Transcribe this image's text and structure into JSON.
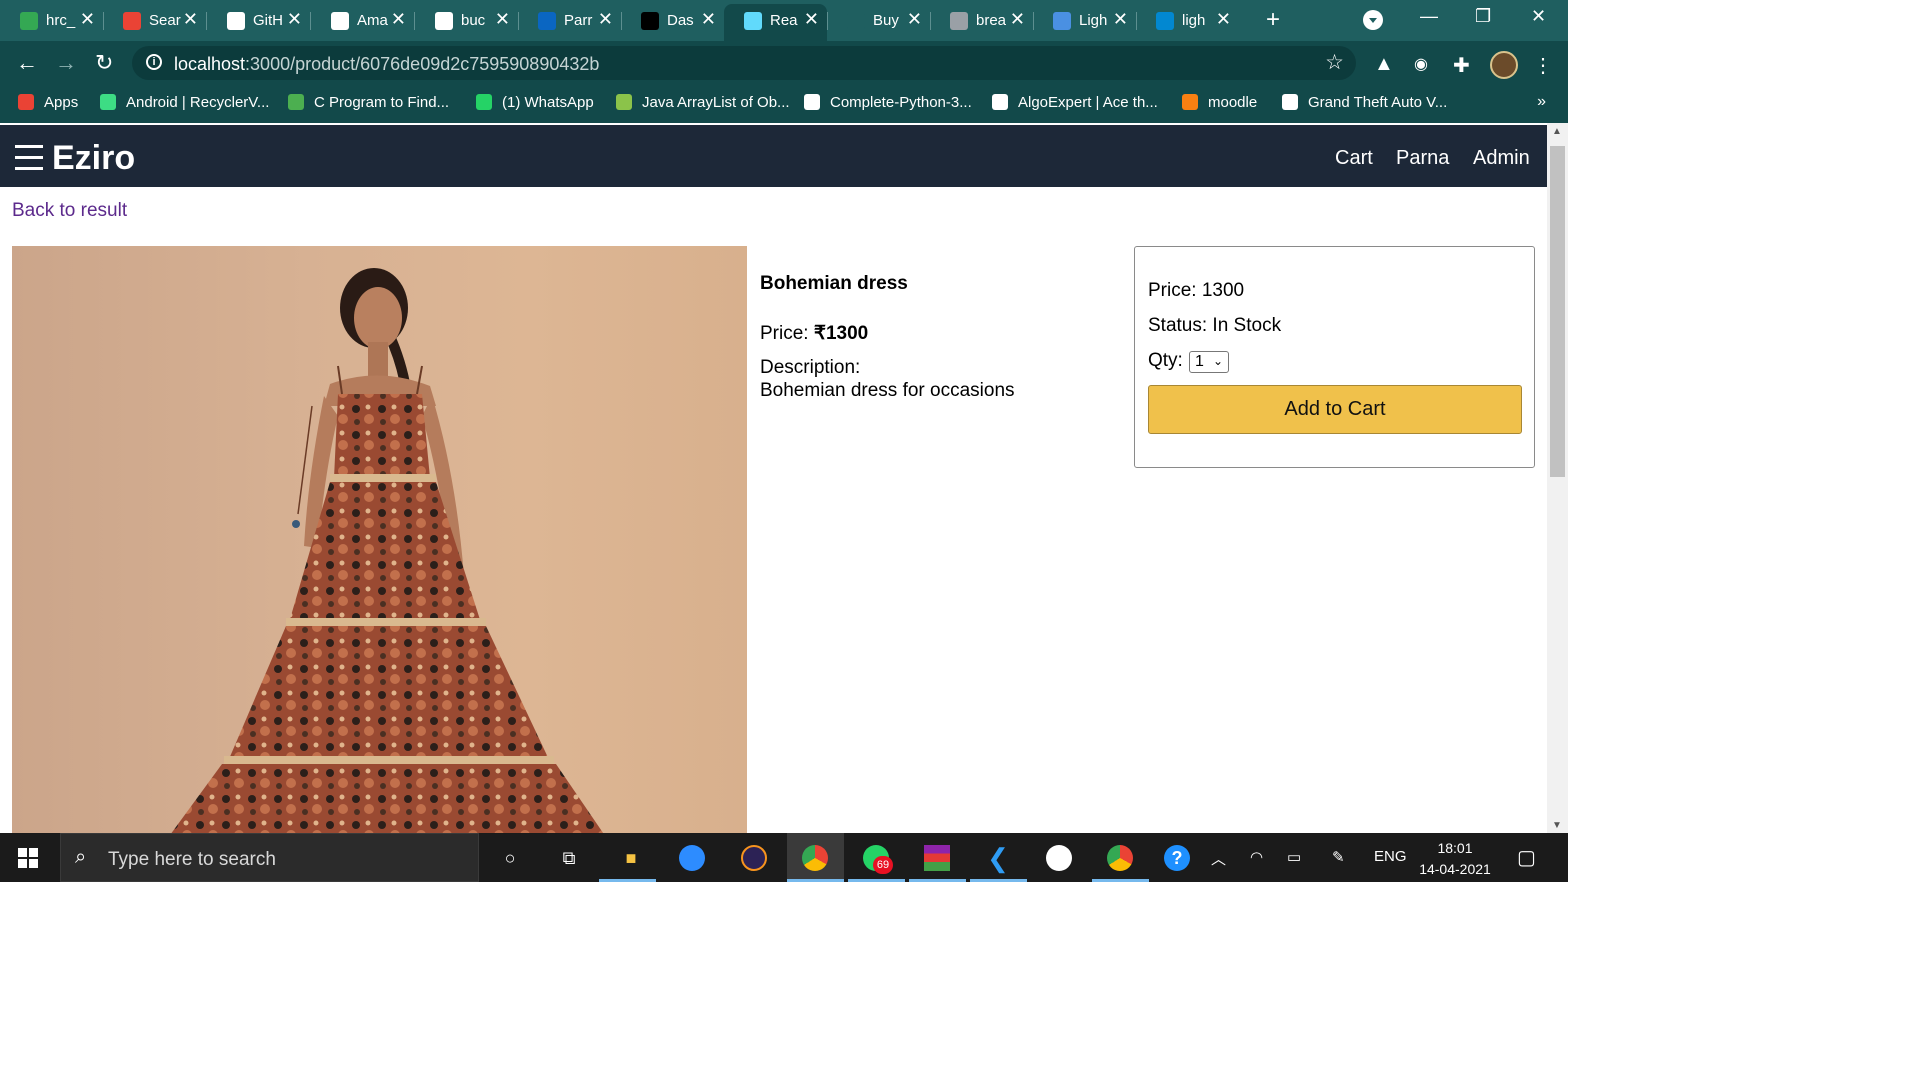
{
  "browser": {
    "tabs": [
      {
        "label": "hrc_",
        "icon": "google-drive-icon",
        "color": "#34a853"
      },
      {
        "label": "Sear",
        "icon": "gmail-icon",
        "color": "#ea4335"
      },
      {
        "label": "GitH",
        "icon": "github-icon",
        "color": "#ffffff"
      },
      {
        "label": "Ama",
        "icon": "amazon-icon",
        "color": "#ffffff"
      },
      {
        "label": "buc",
        "icon": "google-icon",
        "color": "#ffffff"
      },
      {
        "label": "Parr",
        "icon": "linkedin-icon",
        "color": "#0a66c2"
      },
      {
        "label": "Das",
        "icon": "dashboard-icon",
        "color": "#000000"
      },
      {
        "label": "Rea",
        "icon": "react-icon",
        "color": "#61dafb"
      },
      {
        "label": "Buy",
        "icon": "shop-icon",
        "color": "#1f5f60"
      },
      {
        "label": "brea",
        "icon": "globe-icon",
        "color": "#9aa0a6"
      },
      {
        "label": "Ligh",
        "icon": "colorzilla-icon",
        "color": "#4a90e2"
      },
      {
        "label": "ligh",
        "icon": "c-icon",
        "color": "#0288d1"
      }
    ],
    "active_tab_index": 7,
    "url_host": "localhost",
    "url_path": ":3000/product/6076de09d2c759590890432b",
    "bookmarks": [
      {
        "label": "Apps",
        "icon": "apps-grid-icon",
        "color": "#ea4335"
      },
      {
        "label": "Android | RecyclerV...",
        "icon": "android-icon",
        "color": "#3ddc84"
      },
      {
        "label": "C Program to Find...",
        "icon": "site-icon",
        "color": "#4caf50"
      },
      {
        "label": "(1) WhatsApp",
        "icon": "whatsapp-icon",
        "color": "#25d366"
      },
      {
        "label": "Java ArrayList of Ob...",
        "icon": "b-icon",
        "color": "#8bc34a"
      },
      {
        "label": "Complete-Python-3...",
        "icon": "github-icon",
        "color": "#ffffff"
      },
      {
        "label": "AlgoExpert | Ace th...",
        "icon": "algoexpert-icon",
        "color": "#ffffff"
      },
      {
        "label": "moodle",
        "icon": "moodle-icon",
        "color": "#f98012"
      },
      {
        "label": "Grand Theft Auto V...",
        "icon": "epic-icon",
        "color": "#ffffff"
      }
    ]
  },
  "app": {
    "brand": "Eziro",
    "nav": {
      "cart": "Cart",
      "user": "Parna",
      "admin": "Admin"
    },
    "back_link": "Back to result",
    "product": {
      "name": "Bohemian dress",
      "price_label": "Price: ",
      "price_value": "₹1300",
      "description_label": "Description:",
      "description": "Bohemian dress for occasions"
    },
    "buy_box": {
      "price": "Price: 1300",
      "status": "Status: In Stock",
      "qty_label": "Qty:",
      "qty_value": "1",
      "add_to_cart": "Add to Cart"
    }
  },
  "taskbar": {
    "search_placeholder": "Type here to search",
    "whatsapp_badge": "69",
    "language": "ENG",
    "time": "18:01",
    "date": "14-04-2021"
  }
}
